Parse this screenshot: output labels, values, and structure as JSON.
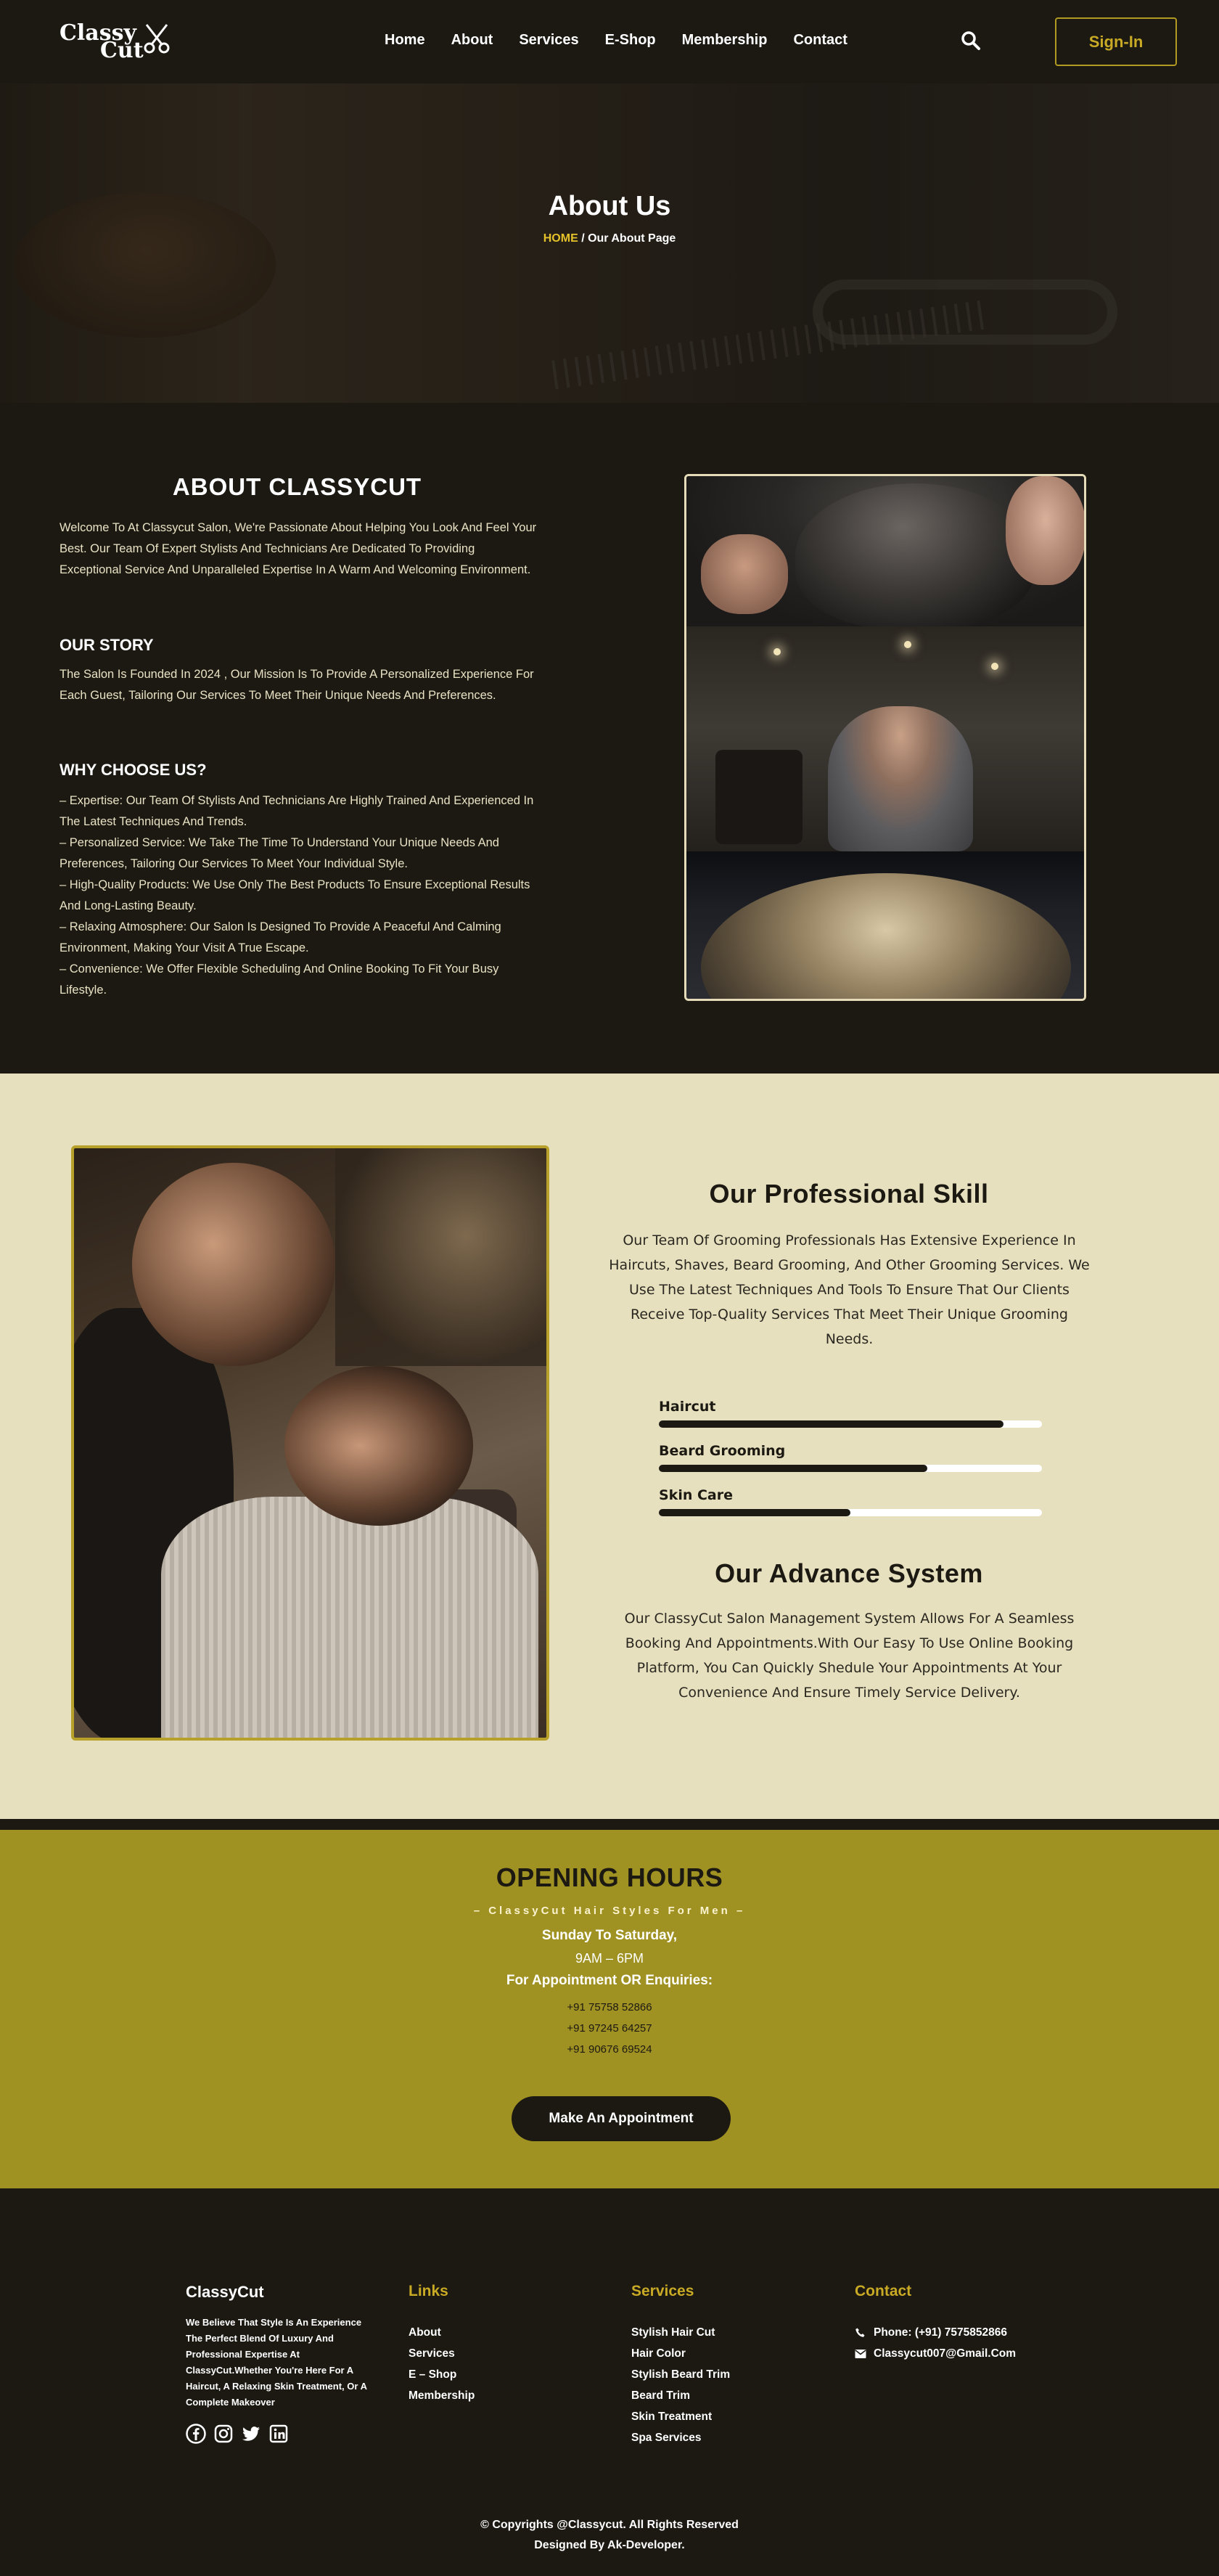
{
  "nav": {
    "logo_line1": "Classy",
    "logo_line2": "Cut",
    "items": [
      "Home",
      "About",
      "Services",
      "E-Shop",
      "Membership",
      "Contact"
    ],
    "signin": "Sign-In"
  },
  "hero": {
    "title": "About Us",
    "crumb_home": "HOME",
    "crumb_rest": "/ Our About Page"
  },
  "about": {
    "title": "ABOUT CLASSYCUT",
    "intro": "Welcome To At Classycut Salon, We're Passionate About Helping You Look And Feel Your Best. Our Team Of Expert Stylists And Technicians Are Dedicated To Providing Exceptional Service And Unparalleled Expertise In A Warm And Welcoming Environment.",
    "story_title": "OUR STORY",
    "story": "The Salon Is Founded In 2024 , Our Mission Is To Provide A Personalized Experience For Each Guest, Tailoring Our Services To Meet Their Unique Needs And Preferences.",
    "why_title": "WHY CHOOSE US?",
    "why": [
      "– Expertise: Our Team Of Stylists And Technicians Are Highly Trained And Experienced In The Latest Techniques And Trends.",
      "– Personalized Service: We Take The Time To Understand Your Unique Needs And Preferences, Tailoring Our Services To Meet Your Individual Style.",
      "– High-Quality Products: We Use Only The Best Products To Ensure Exceptional Results And Long-Lasting Beauty.",
      "– Relaxing Atmosphere: Our Salon Is Designed To Provide A Peaceful And Calming Environment, Making Your Visit A True Escape.",
      "– Convenience: We Offer Flexible Scheduling And Online Booking To Fit Your Busy Lifestyle."
    ]
  },
  "skill": {
    "title": "Our Professional Skill",
    "desc": "Our Team Of Grooming Professionals Has Extensive Experience In Haircuts, Shaves, Beard Grooming, And Other Grooming Services. We Use The Latest Techniques And Tools To Ensure That Our Clients Receive Top-Quality Services That Meet Their Unique Grooming Needs.",
    "bars": [
      {
        "label": "Haircut",
        "percent": 90
      },
      {
        "label": "Beard Grooming",
        "percent": 70
      },
      {
        "label": "Skin Care",
        "percent": 50
      }
    ],
    "adv_title": "Our Advance System",
    "adv_desc": "Our ClassyCut Salon Management System Allows For A Seamless Booking And Appointments.With Our Easy To Use Online Booking Platform, You Can Quickly Shedule Your Appointments At Your Convenience And Ensure Timely Service Delivery."
  },
  "hours": {
    "title": "OPENING HOURS",
    "tagline": "– ClassyCut Hair Styles For Men –",
    "days": "Sunday To Saturday,",
    "time": "9AM – 6PM",
    "enquiry": "For Appointment OR Enquiries:",
    "phones": [
      "+91 75758 52866",
      "+91 97245 64257",
      "+91 90676 69524"
    ],
    "button": "Make An Appointment"
  },
  "footer": {
    "brand": "ClassyCut",
    "about": "We Believe That Style Is An Experience The Perfect Blend Of Luxury And Professional Expertise At ClassyCut.Whether You're Here For A Haircut, A Relaxing Skin Treatment, Or A Complete Makeover",
    "links_title": "Links",
    "links": [
      "About",
      "Services",
      "E – Shop",
      "Membership"
    ],
    "services_title": "Services",
    "services": [
      "Stylish Hair Cut",
      "Hair Color",
      "Stylish Beard Trim",
      "Beard Trim",
      "Skin Treatment",
      "Spa Services"
    ],
    "contact_title": "Contact",
    "phone": "Phone: (+91) 7575852866",
    "email": "Classycut007@Gmail.Com",
    "copyright": "© Copyrights @Classycut. All Rights Reserved",
    "designer": "Designed By Ak-Developer."
  }
}
